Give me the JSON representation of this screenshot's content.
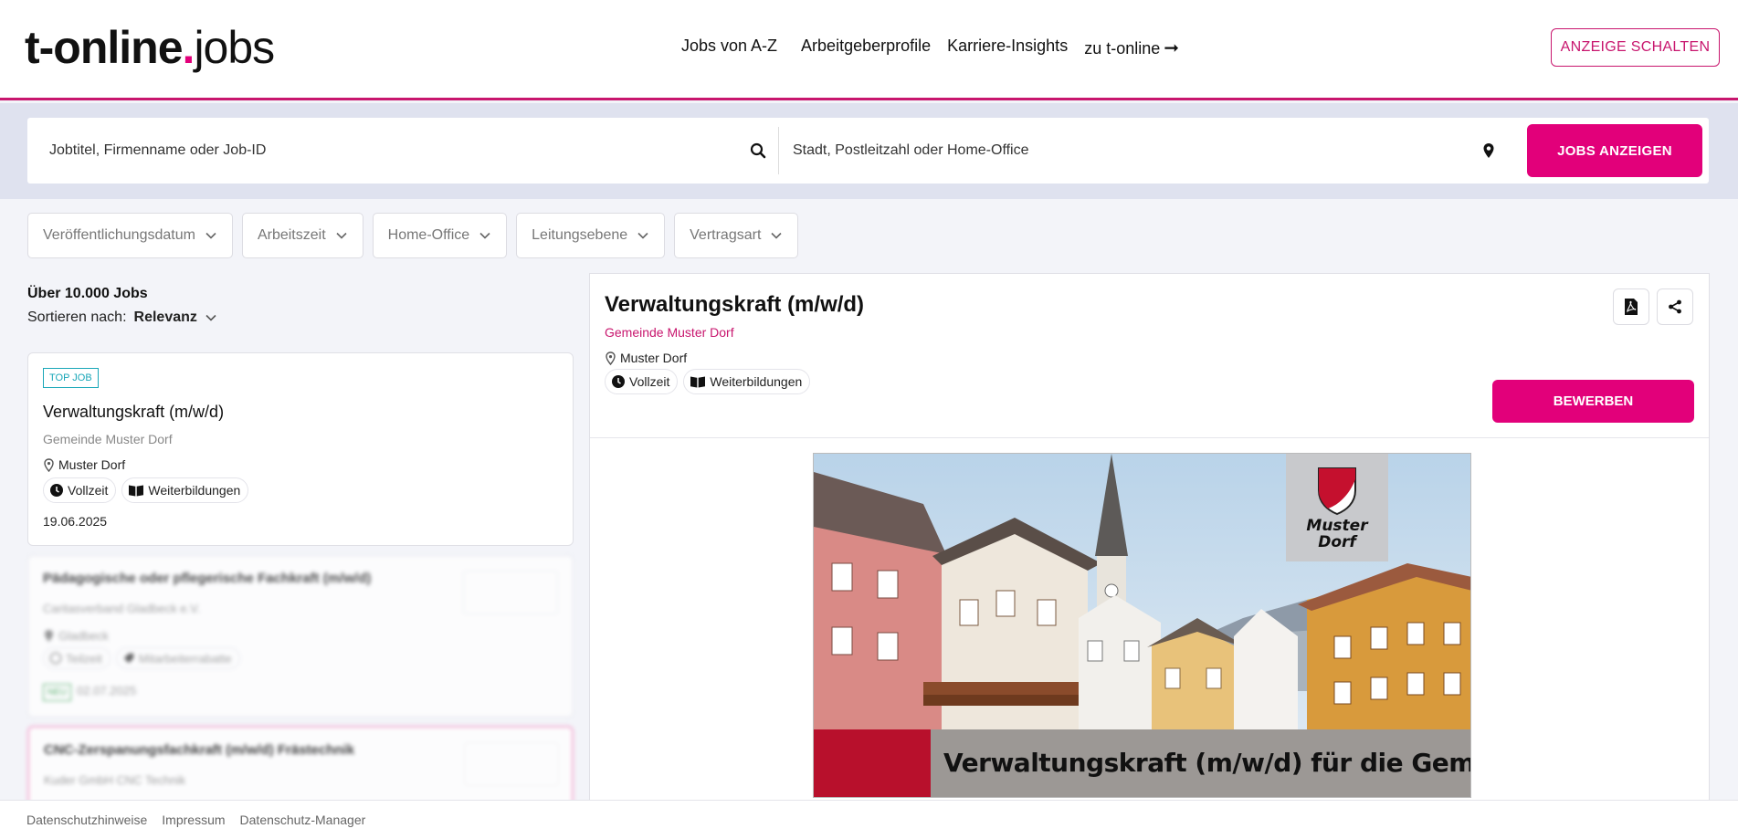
{
  "header": {
    "logo": {
      "part1": "t-online",
      "dot": ".",
      "part2": "jobs"
    },
    "nav": [
      {
        "label": "Jobs von A-Z"
      },
      {
        "label": "Arbeitgeberprofile"
      },
      {
        "label": "Karriere-Insights"
      },
      {
        "label": "zu t-online"
      }
    ],
    "cta_label": "ANZEIGE SCHALTEN"
  },
  "search": {
    "keyword_placeholder": "Jobtitel, Firmenname oder Job-ID",
    "location_placeholder": "Stadt, Postleitzahl oder Home-Office",
    "submit_label": "JOBS  ANZEIGEN"
  },
  "filters": [
    {
      "label": "Veröffentlichungsdatum"
    },
    {
      "label": "Arbeitszeit"
    },
    {
      "label": "Home-Office"
    },
    {
      "label": "Leitungsebene"
    },
    {
      "label": "Vertragsart"
    }
  ],
  "results": {
    "count_prefix": "Über ",
    "count_value": "10.000",
    "count_suffix": " Jobs",
    "sort_label": "Sortieren nach:",
    "sort_value": "Relevanz"
  },
  "jobs": [
    {
      "badge": "TOP JOB",
      "title": "Verwaltungskraft (m/w/d)",
      "company": "Gemeinde Muster Dorf",
      "location": "Muster Dorf",
      "tags": [
        "Vollzeit",
        "Weiterbildungen"
      ],
      "date": "19.06.2025"
    },
    {
      "title": "Pädagogische oder pflegerische Fachkraft (m/w/d)",
      "company": "Caritasverband Gladbeck e.V.",
      "location": "Gladbeck",
      "tags": [
        "Teilzeit",
        "Mitarbeiterrabatte"
      ],
      "badge": "NEU",
      "date": "02.07.2025"
    },
    {
      "title": "CNC-Zerspanungsfachkraft (m/w/d) Frästechnik",
      "company": "Kuder GmbH CNC Technik"
    }
  ],
  "detail": {
    "title": "Verwaltungskraft (m/w/d)",
    "company": "Gemeinde Muster Dorf",
    "location": "Muster Dorf",
    "tags": [
      "Vollzeit",
      "Weiterbildungen"
    ],
    "apply_label": "BEWERBEN",
    "hero": {
      "crest_line1": "Muster",
      "crest_line2": "Dorf",
      "caption": "Verwaltungskraft (m/w/d) für die Gemeinde"
    }
  },
  "footer": {
    "links": [
      {
        "label": "Datenschutzhinweise"
      },
      {
        "label": "Impressum"
      },
      {
        "label": "Datenschutz-Manager"
      }
    ]
  },
  "colors": {
    "brand": "#e2007a",
    "brand_dark": "#c8166e",
    "top_job": "#1aa7b8",
    "new": "#2a9a43"
  }
}
